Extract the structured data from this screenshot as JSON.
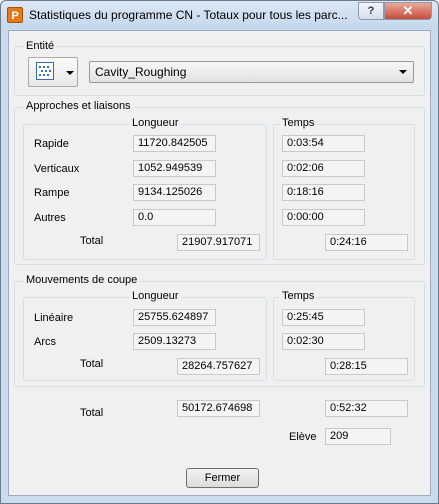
{
  "window": {
    "title": "Statistiques du programme CN - Totaux pour tous les parc..."
  },
  "titlebar_buttons": {
    "help": "?",
    "close": "✕"
  },
  "entity": {
    "label": "Entité",
    "selected": "Cavity_Roughing",
    "icon": "toolpath-icon"
  },
  "approaches": {
    "title": "Approches et liaisons",
    "length_header": "Longueur",
    "time_header": "Temps",
    "rows": [
      {
        "label": "Rapide",
        "length": "11720.842505",
        "time": "0:03:54"
      },
      {
        "label": "Verticaux",
        "length": "1052.949539",
        "time": "0:02:06"
      },
      {
        "label": "Rampe",
        "length": "9134.125026",
        "time": "0:18:16"
      },
      {
        "label": "Autres",
        "length": "0.0",
        "time": "0:00:00"
      }
    ],
    "total_label": "Total",
    "total_length": "21907.917071",
    "total_time": "0:24:16"
  },
  "cutting": {
    "title": "Mouvements de coupe",
    "length_header": "Longueur",
    "time_header": "Temps",
    "rows": [
      {
        "label": "Linéaire",
        "length": "25755.624897",
        "time": "0:25:45"
      },
      {
        "label": "Arcs",
        "length": "2509.13273",
        "time": "0:02:30"
      }
    ],
    "total_label": "Total",
    "total_length": "28264.757627",
    "total_time": "0:28:15"
  },
  "grand_total": {
    "label": "Total",
    "length": "50172.674698",
    "time": "0:52:32"
  },
  "lift": {
    "label": "Elève",
    "value": "209"
  },
  "close_button": "Fermer",
  "colors": {
    "frame": "#c9dbee",
    "close": "#c74c3a",
    "app_icon": "#e37b1a"
  }
}
